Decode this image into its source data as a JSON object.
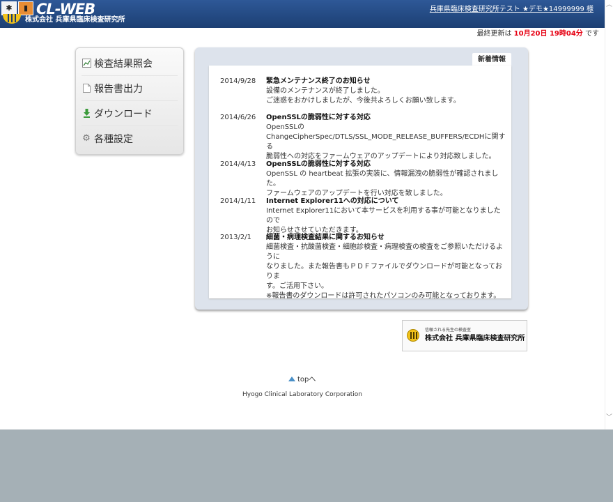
{
  "header": {
    "brand": "CL-WEB",
    "company": "株式会社 兵庫県臨床検査研究所",
    "user_link": "兵庫県臨床検査研究所テスト ★デモ★14999999 様"
  },
  "last_updated": {
    "prefix": "最終更新は ",
    "date": "10月20日 19時04分",
    "suffix": " です"
  },
  "menu": {
    "items": [
      {
        "label": "検査結果照会",
        "icon": "chart-icon"
      },
      {
        "label": "報告書出力",
        "icon": "document-icon"
      },
      {
        "label": "ダウンロード",
        "icon": "download-arrow-icon"
      },
      {
        "label": "各種設定",
        "icon": "gear-icon"
      }
    ]
  },
  "news": {
    "tab_label": "新着情報",
    "entries": [
      {
        "date": "2014/9/28",
        "title": "緊急メンテナンス終了のお知らせ",
        "lines": [
          "設備のメンテナンスが終了しました。",
          "ご迷惑をおかけしましたが、今後共よろしくお願い致します。"
        ]
      },
      {
        "date": "2014/6/26",
        "title": "OpenSSLの脆弱性に対する対応",
        "lines": [
          "OpenSSLの",
          "ChangeCipherSpec/DTLS/SSL_MODE_RELEASE_BUFFERS/ECDHに関する",
          "脆弱性への対応をファームウェアのアップデートにより対応致しました。"
        ]
      },
      {
        "date": "2014/4/13",
        "title": "OpenSSLの脆弱性に対する対応",
        "lines": [
          "OpenSSL の heartbeat 拡張の実装に、情報漏洩の脆弱性が確認されました。",
          "ファームウェアのアップデートを行い対応を致しました。"
        ]
      },
      {
        "date": "2014/1/11",
        "title": "Internet Explorer11への対応について",
        "lines": [
          "Internet Explorer11において本サービスを利用する事が可能となりましたので",
          "お知らせさせていただきます。"
        ]
      },
      {
        "date": "2013/2/1",
        "title": "細菌・病理検査結果に関するお知らせ",
        "lines": [
          "細菌検査・抗酸菌検査・細胞診検査・病理検査の検査をご参照いただけるように",
          "なりました。また報告書もＰＤＦファイルでダウンロードが可能となっておりま",
          "す。ご活用下さい。",
          "※報告書のダウンロードは許可されたパソコンのみ可能となっております。"
        ]
      }
    ]
  },
  "footer": {
    "logo_tagline": "信頼される先生の検査室",
    "logo_name": "株式会社 兵庫県臨床検査研究所",
    "top_link": "topへ",
    "copyright": "Hyogo Clinical Laboratory Corporation"
  }
}
